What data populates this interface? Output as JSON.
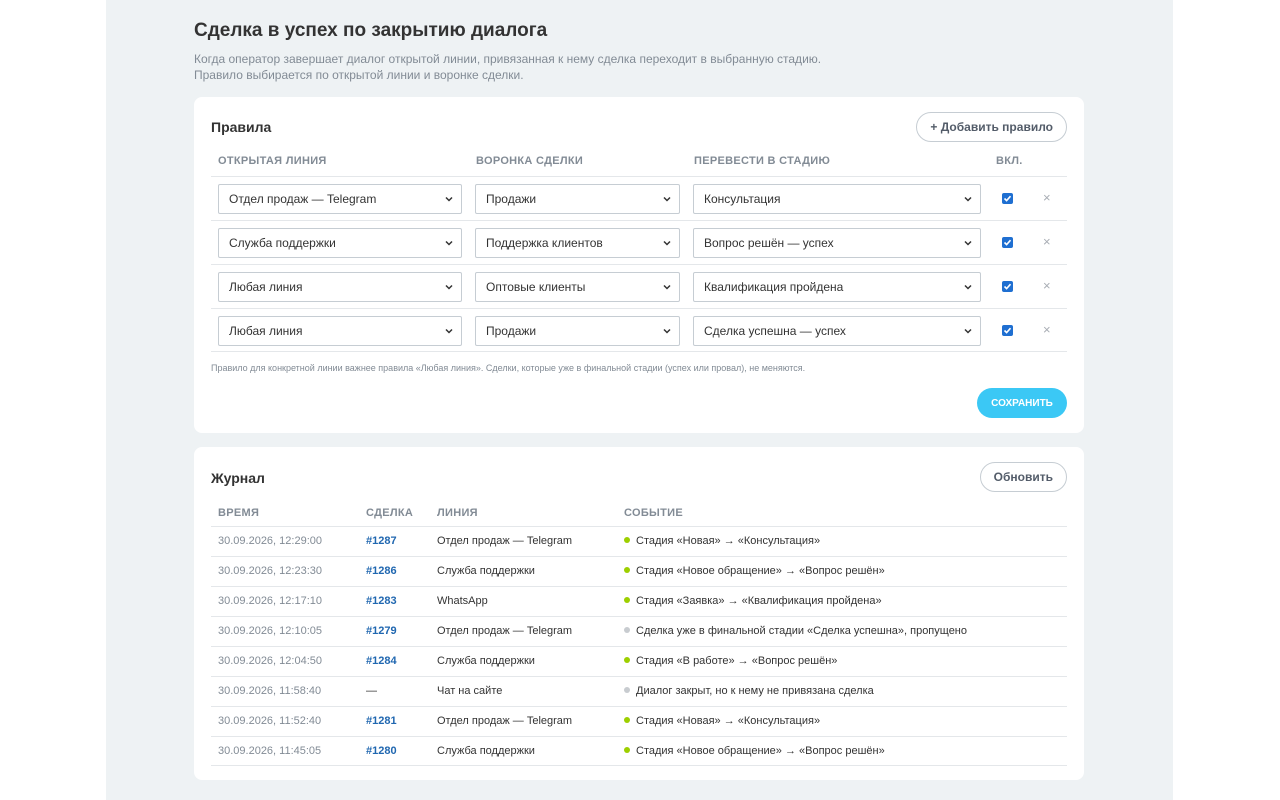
{
  "header": {
    "title": "Сделка в успех по закрытию диалога",
    "description_line1": "Когда оператор завершает диалог открытой линии, привязанная к нему сделка переходит в выбранную стадию.",
    "description_line2": "Правило выбирается по открытой линии и воронке сделки."
  },
  "rules": {
    "title": "Правила",
    "add_button": "+ Добавить правило",
    "columns": {
      "line": "Открытая линия",
      "funnel": "Воронка сделки",
      "stage": "Перевести в стадию",
      "enabled": "Вкл."
    },
    "rows": [
      {
        "line": "Отдел продаж — Telegram",
        "funnel": "Продажи",
        "stage": "Консультация",
        "enabled": true
      },
      {
        "line": "Служба поддержки",
        "funnel": "Поддержка клиентов",
        "stage": "Вопрос решён — успех",
        "enabled": true
      },
      {
        "line": "Любая линия",
        "funnel": "Оптовые клиенты",
        "stage": "Квалификация пройдена",
        "enabled": true
      },
      {
        "line": "Любая линия",
        "funnel": "Продажи",
        "stage": "Сделка успешна — успех",
        "enabled": true
      }
    ],
    "delete_glyph": "×",
    "note": "Правило для конкретной линии важнее правила «Любая линия». Сделки, которые уже в финальной стадии (успех или провал), не меняются.",
    "save_button": "Сохранить"
  },
  "log": {
    "title": "Журнал",
    "refresh_button": "Обновить",
    "columns": {
      "time": "Время",
      "deal": "Сделка",
      "line": "Линия",
      "event": "Событие"
    },
    "status_colors": {
      "success": "#9dcf00",
      "skipped": "#c8ccd0"
    },
    "rows": [
      {
        "time": "30.09.2026, 12:29:00",
        "deal": "#1287",
        "line": "Отдел продаж — Telegram",
        "event": "Стадия «Новая» → «Консультация»",
        "status": "success"
      },
      {
        "time": "30.09.2026, 12:23:30",
        "deal": "#1286",
        "line": "Служба поддержки",
        "event": "Стадия «Новое обращение» → «Вопрос решён»",
        "status": "success"
      },
      {
        "time": "30.09.2026, 12:17:10",
        "deal": "#1283",
        "line": "WhatsApp",
        "event": "Стадия «Заявка» → «Квалификация пройдена»",
        "status": "success"
      },
      {
        "time": "30.09.2026, 12:10:05",
        "deal": "#1279",
        "line": "Отдел продаж — Telegram",
        "event": "Сделка уже в финальной стадии «Сделка успешна», пропущено",
        "status": "skipped"
      },
      {
        "time": "30.09.2026, 12:04:50",
        "deal": "#1284",
        "line": "Служба поддержки",
        "event": "Стадия «В работе» → «Вопрос решён»",
        "status": "success"
      },
      {
        "time": "30.09.2026, 11:58:40",
        "deal": "—",
        "line": "Чат на сайте",
        "event": "Диалог закрыт, но к нему не привязана сделка",
        "status": "skipped"
      },
      {
        "time": "30.09.2026, 11:52:40",
        "deal": "#1281",
        "line": "Отдел продаж — Telegram",
        "event": "Стадия «Новая» → «Консультация»",
        "status": "success"
      },
      {
        "time": "30.09.2026, 11:45:05",
        "deal": "#1280",
        "line": "Служба поддержки",
        "event": "Стадия «Новое обращение» → «Вопрос решён»",
        "status": "success"
      }
    ]
  }
}
